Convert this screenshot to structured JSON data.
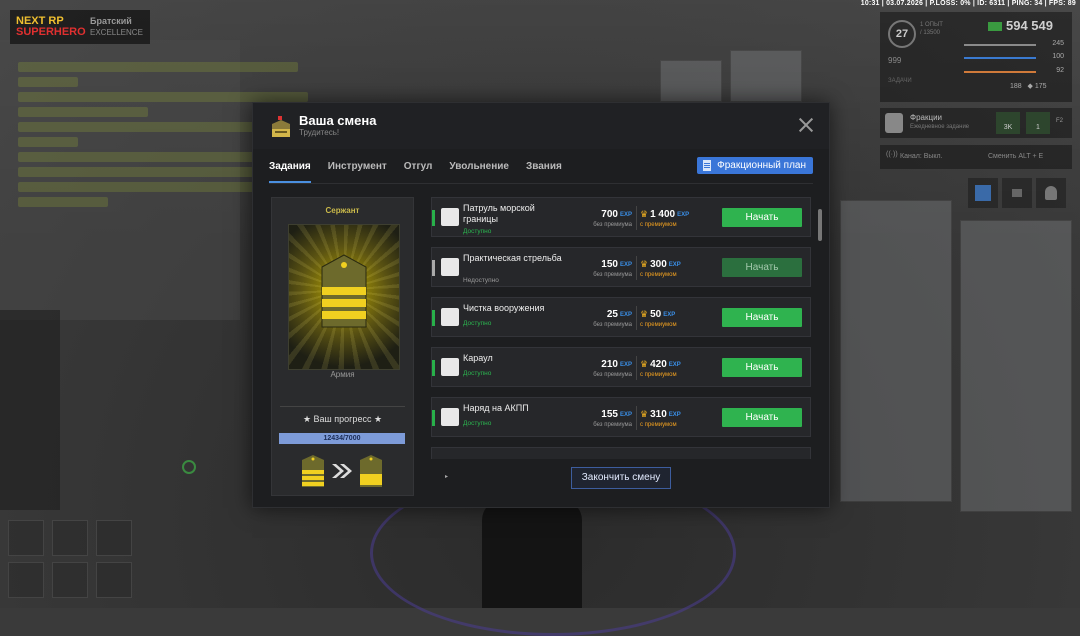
{
  "hud": {
    "topbar": "10:31 | 03.07.2026 | P.LOSS: 0% | ID: 6311 | PING: 34 | FPS: 89",
    "level": "27",
    "level_lines": [
      "1 ОПЫТ",
      "/ 13500"
    ],
    "money": "594 549",
    "hp": "245",
    "armor": "100",
    "food": "92",
    "extra": "175",
    "score": "999",
    "ammo": "188",
    "subtext": "ЗАДАЧИ"
  },
  "logo": {
    "brand_a": "NEXT RP",
    "brand_b": "SUPERHERO",
    "server": "Братский",
    "server_sub": "EXCELLENCE"
  },
  "faction": {
    "title": "Фракции",
    "subtitle": "Ежедневное задание",
    "count1": "3K",
    "count2": "1",
    "key": "F2"
  },
  "channel": {
    "label": "Канал:  Выкл.",
    "hint": "Сменить  ALT + E"
  },
  "modal": {
    "title": "Ваша смена",
    "subtitle": "Трудитесь!",
    "tabs": [
      "Задания",
      "Инструмент",
      "Отгул",
      "Увольнение",
      "Звания"
    ],
    "plan_button": "Фракционный план",
    "finish_button": "Закончить смену",
    "rank": {
      "name": "Сержант",
      "faction": "Армия",
      "progress_label": "★ Ваш прогресс ★",
      "progress_text": "12434/7000",
      "progress_fraction": 1.0
    },
    "exp_unit": "EXP",
    "label_no_premium": "без премиума",
    "label_premium": "с премиумом",
    "tasks": [
      {
        "name": "Патруль морской границы",
        "status": "Доступно",
        "available": true,
        "exp": "700",
        "exp_premium": "1 400",
        "button": "Начать"
      },
      {
        "name": "Практическая стрельба",
        "status": "Недоступно",
        "available": false,
        "exp": "150",
        "exp_premium": "300",
        "button": "Начать"
      },
      {
        "name": "Чистка вооружения",
        "status": "Доступно",
        "available": true,
        "exp": "25",
        "exp_premium": "50",
        "button": "Начать"
      },
      {
        "name": "Караул",
        "status": "Доступно",
        "available": true,
        "exp": "210",
        "exp_premium": "420",
        "button": "Начать"
      },
      {
        "name": "Наряд на АКПП",
        "status": "Доступно",
        "available": true,
        "exp": "155",
        "exp_premium": "310",
        "button": "Начать"
      }
    ]
  },
  "colors": {
    "accent": "#3a76d8",
    "start_green": "#2fb34f",
    "rank_gold": "#e6c800",
    "premium_orange": "#f0a020"
  }
}
